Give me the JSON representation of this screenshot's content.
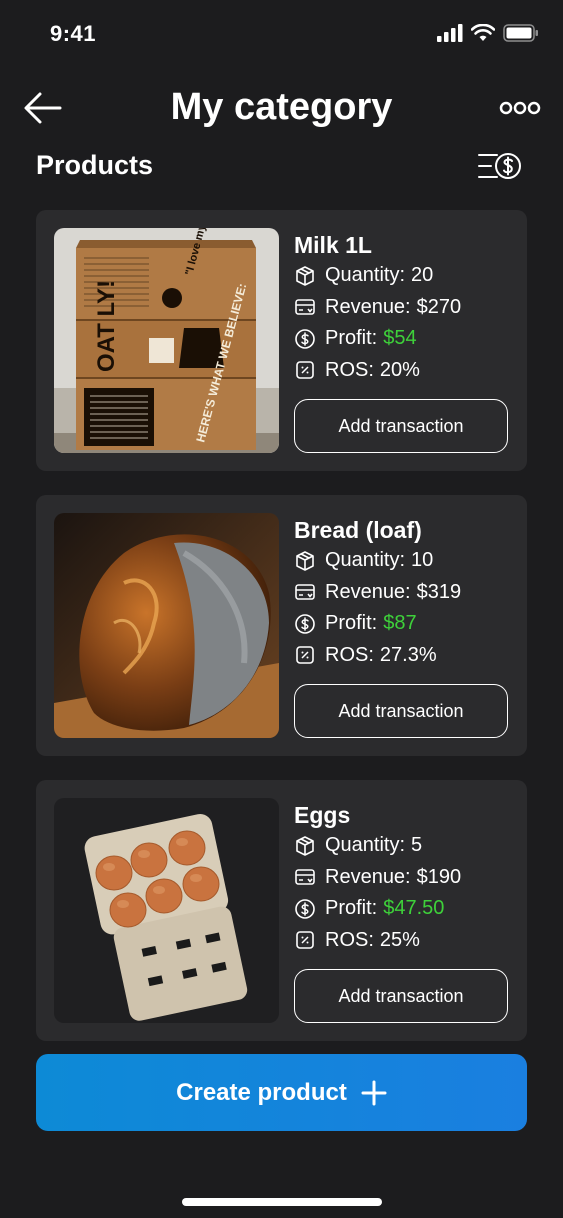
{
  "status_bar": {
    "time": "9:41"
  },
  "header": {
    "title": "My category"
  },
  "section": {
    "title": "Products"
  },
  "products": [
    {
      "name": "Milk 1L",
      "quantity_label": "Quantity:",
      "quantity": "20",
      "revenue_label": "Revenue:",
      "revenue": "$270",
      "profit_label": "Profit:",
      "profit": "$54",
      "ros_label": "ROS:",
      "ros": "20%",
      "button": "Add transaction",
      "carton_text_1": "\"I love my products\"",
      "carton_text_2": "OAT LY!",
      "carton_text_3": "HERE'S WHAT WE BELIEVE:"
    },
    {
      "name": "Bread (loaf)",
      "quantity_label": "Quantity:",
      "quantity": "10",
      "revenue_label": "Revenue:",
      "revenue": "$319",
      "profit_label": "Profit:",
      "profit": "$87",
      "ros_label": "ROS:",
      "ros": "27.3%",
      "button": "Add transaction"
    },
    {
      "name": "Eggs",
      "quantity_label": "Quantity:",
      "quantity": "5",
      "revenue_label": "Revenue:",
      "revenue": "$190",
      "profit_label": "Profit:",
      "profit": "$47.50",
      "ros_label": "ROS:",
      "ros": "25%",
      "button": "Add transaction"
    }
  ],
  "create_button": {
    "label": "Create product"
  },
  "colors": {
    "background": "#1c1c1e",
    "card": "#2b2b2d",
    "profit": "#3ed13a",
    "accent": "#1a7fe0"
  },
  "icons": [
    "back-arrow-icon",
    "more-icon",
    "sort-dollar-icon",
    "box-icon",
    "card-icon",
    "dollar-circle-icon",
    "percent-icon",
    "plus-icon"
  ]
}
